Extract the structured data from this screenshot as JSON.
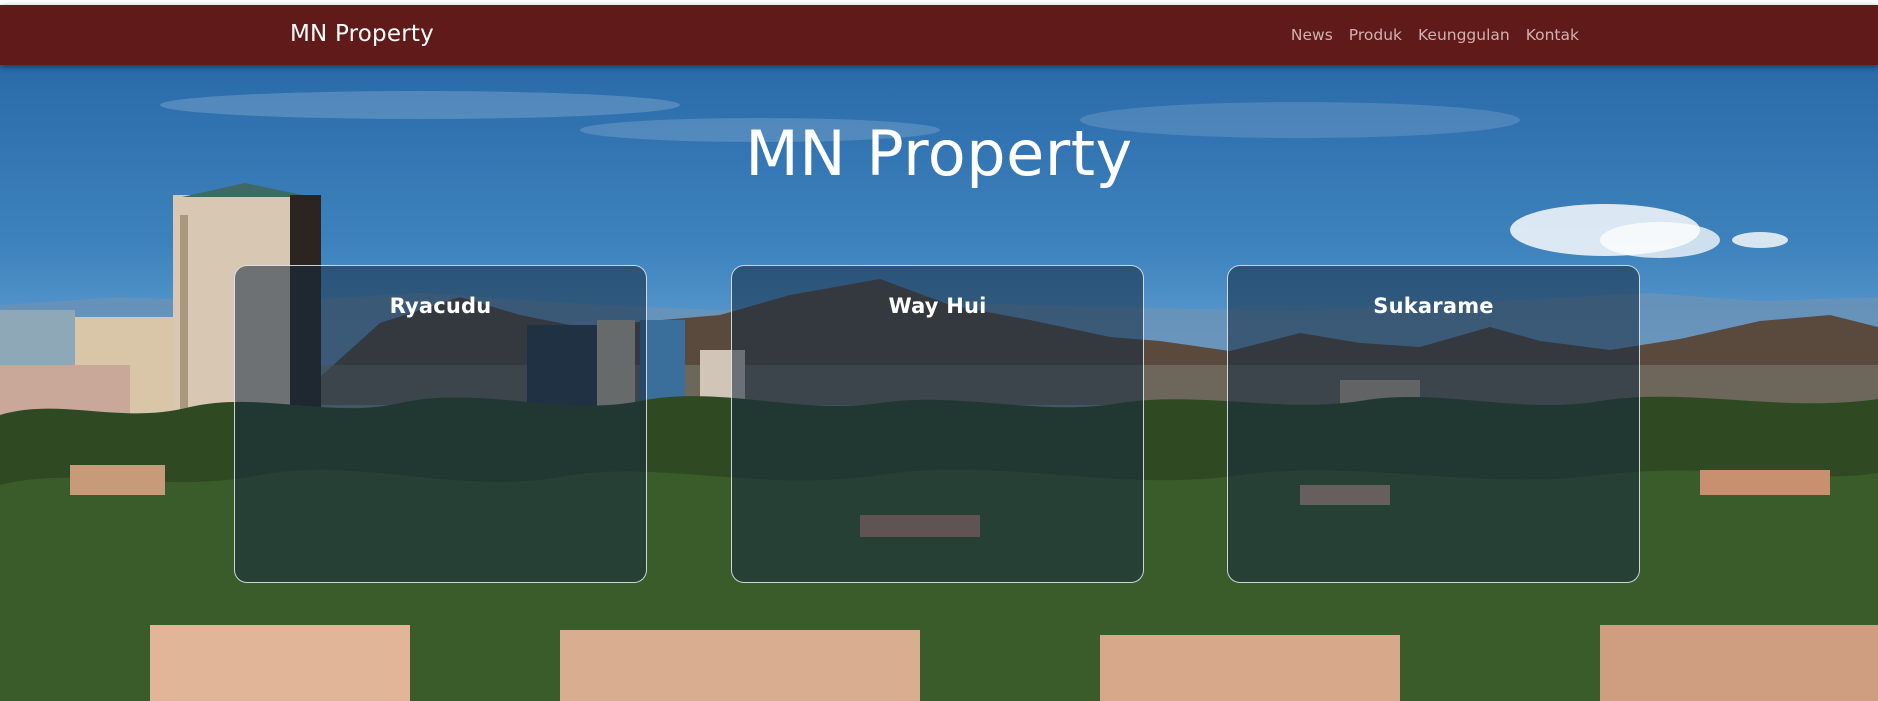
{
  "navbar": {
    "brand": "MN Property",
    "links": [
      "News",
      "Produk",
      "Keunggulan",
      "Kontak"
    ]
  },
  "hero": {
    "title": "MN Property",
    "background": "city-skyline-photo"
  },
  "cards": [
    {
      "title": "Ryacudu"
    },
    {
      "title": "Way Hui"
    },
    {
      "title": "Sukarame"
    }
  ],
  "colors": {
    "navbar_bg": "#611a1a",
    "nav_link": "#cfb2b2",
    "card_border": "#ffffff"
  }
}
